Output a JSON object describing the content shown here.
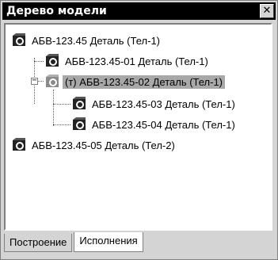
{
  "window": {
    "title": "Дерево модели",
    "close_glyph": "✕"
  },
  "tree": {
    "items": [
      {
        "label": "АБВ-123.45 Деталь (Тел-1)",
        "icon": "part-icon",
        "level": 0,
        "selected": false
      },
      {
        "label": "АБВ-123.45-01 Деталь (Тел-1)",
        "icon": "part-icon",
        "level": 1,
        "selected": false
      },
      {
        "label": "(т) АБВ-123.45-02 Деталь (Тел-1)",
        "icon": "part-icon-gray",
        "level": 1,
        "selected": true,
        "expanded": true
      },
      {
        "label": "АБВ-123.45-03 Деталь (Тел-1)",
        "icon": "part-icon",
        "level": 2,
        "selected": false
      },
      {
        "label": "АБВ-123.45-04 Деталь (Тел-1)",
        "icon": "part-icon",
        "level": 2,
        "selected": false
      },
      {
        "label": "АБВ-123.45-05 Деталь (Тел-2)",
        "icon": "part-icon",
        "level": 0,
        "selected": false
      }
    ],
    "expander_glyph": "−"
  },
  "tabs": [
    {
      "label": "Построение",
      "active": false
    },
    {
      "label": "Исполнения",
      "active": true
    }
  ]
}
